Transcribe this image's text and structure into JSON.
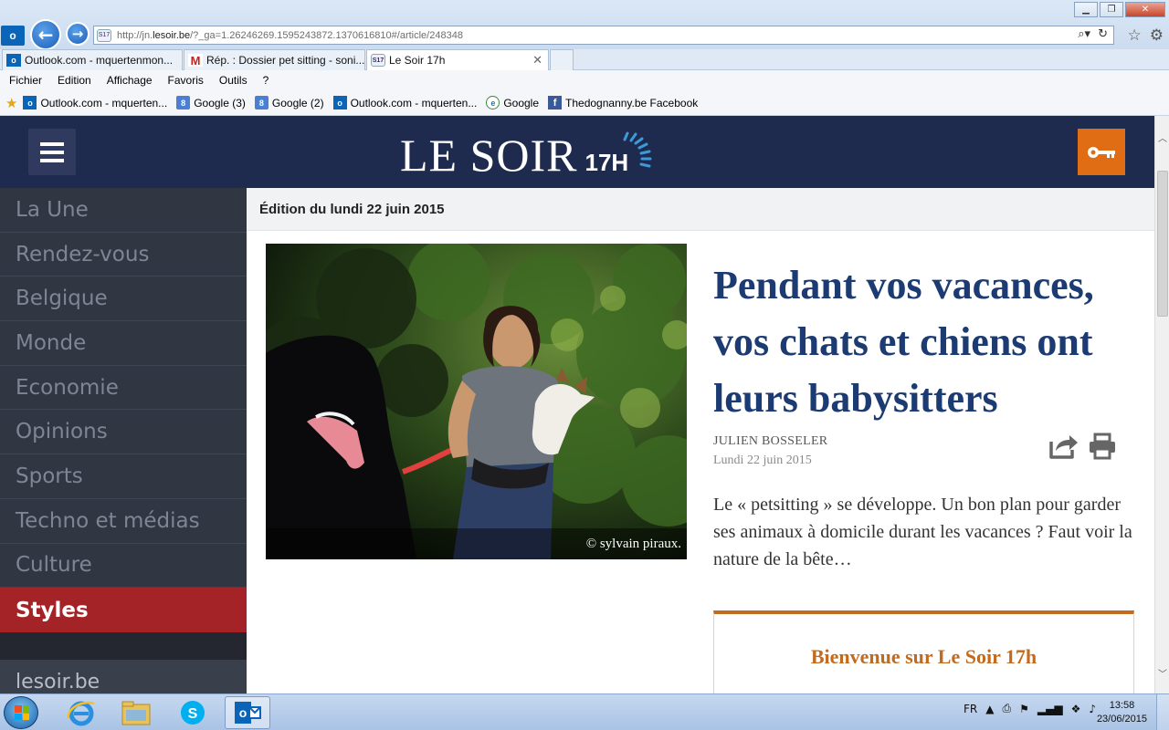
{
  "browser": {
    "url_prefix": "http://jn.",
    "url_host": "lesoir.be",
    "url_rest": "/?_ga=1.26246269.1595243872.1370616810#/article/248348",
    "tabs": [
      {
        "label": "Outlook.com - mquertenmon...",
        "icon": "outlook-icon"
      },
      {
        "label": "Rép. : Dossier pet sitting - soni...",
        "icon": "gmail-icon"
      },
      {
        "label": "Le Soir 17h",
        "icon": "lesoir-icon"
      }
    ],
    "menu": [
      "Fichier",
      "Edition",
      "Affichage",
      "Favoris",
      "Outils",
      "?"
    ],
    "favorites": [
      {
        "label": "Outlook.com - mquerten...",
        "icon": "outlook-icon",
        "glyph": "o"
      },
      {
        "label": "Google (3)",
        "icon": "google-icon",
        "glyph": "8"
      },
      {
        "label": "Google (2)",
        "icon": "google-icon",
        "glyph": "8"
      },
      {
        "label": "Outlook.com - mquerten...",
        "icon": "outlook-icon",
        "glyph": "o"
      },
      {
        "label": "Google",
        "icon": "ie-page-icon",
        "glyph": "e"
      },
      {
        "label": "Thedognanny.be  Facebook",
        "icon": "facebook-icon",
        "glyph": "f"
      }
    ]
  },
  "site": {
    "logo_main": "LE SOIR",
    "logo_sub": "17H",
    "nav": [
      "La Une",
      "Rendez-vous",
      "Belgique",
      "Monde",
      "Economie",
      "Opinions",
      "Sports",
      "Techno et médias",
      "Culture",
      "Styles"
    ],
    "nav_active_index": 9,
    "nav_footer": "lesoir.be"
  },
  "article": {
    "edition": "Édition du lundi 22 juin 2015",
    "title": "Pendant vos vacances, vos chats et chiens ont leurs babysitters",
    "author": "JULIEN BOSSELER",
    "date": "Lundi 22 juin 2015",
    "lead": "Le « petsitting » se développe. Un bon plan pour garder ses animaux à domicile durant les vacances ? Faut voir la nature de la bête…",
    "photo_credit": "©  sylvain piraux.",
    "welcome_title": "Bienvenue sur Le Soir 17h"
  },
  "taskbar": {
    "lang": "FR",
    "time": "13:58",
    "date": "23/06/2015"
  },
  "colors": {
    "header_bg": "#1f2a4f",
    "sidebar_bg": "#313643",
    "active_nav": "#a42326",
    "key_button": "#e06c13",
    "headline": "#1c3b72",
    "accent_orange": "#c46a1c"
  }
}
